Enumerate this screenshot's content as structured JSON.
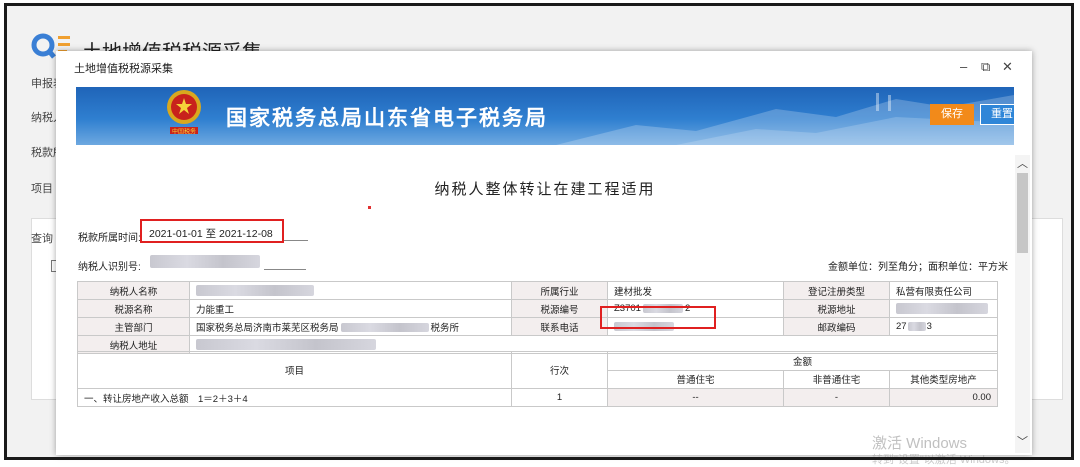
{
  "background": {
    "title": "土地增值税税源采集",
    "labels": [
      "申报表",
      "纳税人",
      "税款所",
      "项目（",
      "查询"
    ]
  },
  "modal": {
    "title": "土地增值税税源采集",
    "minimize": "–",
    "restore": "⧉",
    "close": "✕"
  },
  "banner": {
    "title": "国家税务总局山东省电子税务局",
    "save_label": "保存",
    "reset_label": "重置"
  },
  "form": {
    "doc_title": "纳税人整体转让在建工程适用",
    "period_label": "税款所属时间:",
    "period_value": "2021-01-01 至 2021-12-08",
    "tin_label": "纳税人识别号:",
    "unit_note": "金额单位：列至角分；面积单位：平方米"
  },
  "info_table": {
    "rows": [
      [
        "纳税人名称",
        "",
        "所属行业",
        "建材批发",
        "登记注册类型",
        "私营有限责任公司"
      ],
      [
        "税源名称",
        "力能重工",
        "税源编号",
        "Z3701",
        "税源地址",
        ""
      ],
      [
        "主管部门",
        "国家税务总局济南市莱芜区税务局",
        "联系电话",
        "",
        "邮政编码",
        "27"
      ],
      [
        "纳税人地址",
        "",
        "",
        "",
        "",
        ""
      ]
    ],
    "dept_suffix": "税务所",
    "source_id_suffix": "2",
    "zip_suffix": "3"
  },
  "item_table": {
    "col_item": "项目",
    "col_line": "行次",
    "col_amount": "金额",
    "sub_cols": [
      "普通住宅",
      "非普通住宅",
      "其他类型房地产"
    ],
    "rows": [
      {
        "item": "一、转让房地产收入总额　1＝2＋3＋4",
        "line": "1",
        "ordinary": "--",
        "non_ordinary": "-",
        "other": "0.00"
      }
    ]
  },
  "watermark": {
    "line1": "激活 Windows",
    "line2": "转到\"设置\"以激活 Windows。"
  },
  "colors": {
    "banner": "#2f7fd0",
    "save": "#f28a1a",
    "reset": "#2f86d8",
    "highlight": "#e02020"
  }
}
